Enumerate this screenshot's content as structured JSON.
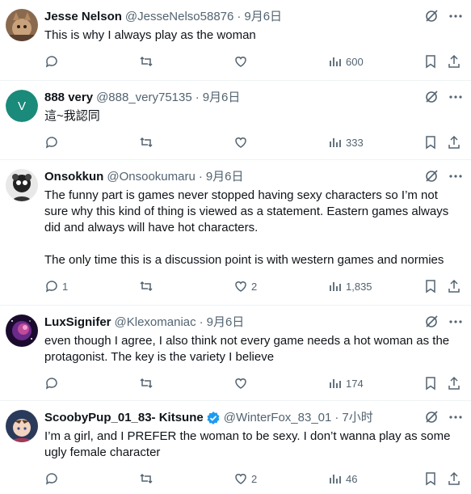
{
  "replies": [
    {
      "name": "Jesse Nelson",
      "handle": "@JesseNelso58876",
      "time": "9月6日",
      "text": [
        "This is why I always play as the woman"
      ],
      "reply_count": "",
      "like_count": "",
      "view_count": "600",
      "avatar": "photo-cat-icon"
    },
    {
      "name": "888 very",
      "handle": "@888_very75135",
      "time": "9月6日",
      "text": [
        "這~我認同"
      ],
      "reply_count": "",
      "like_count": "",
      "view_count": "333",
      "avatar_letter": "V",
      "avatar_color": "#1a8a7a"
    },
    {
      "name": "Onsokkun",
      "handle": "@Onsookumaru",
      "time": "9月6日",
      "text": [
        "The funny part is games never stopped having sexy characters so I’m not sure why this kind of thing is viewed as a statement. Eastern games always did and always will have hot characters.",
        "The only time this is a discussion point is with western games and normies"
      ],
      "reply_count": "1",
      "like_count": "2",
      "view_count": "1,835",
      "avatar": "monochrome-character-icon"
    },
    {
      "name": "LuxSignifer",
      "handle": "@Klexomaniac",
      "time": "9月6日",
      "text": [
        "even though I agree, I also think not every game needs a hot woman as the protagonist. The key is the variety I believe"
      ],
      "reply_count": "",
      "like_count": "",
      "view_count": "174",
      "avatar": "purple-nebula-icon"
    },
    {
      "name": "ScoobyPup_01_83- Kitsune",
      "handle": "@WinterFox_83_01",
      "time": "7小时",
      "verified": true,
      "text": [
        "I’m a girl, and I PREFER the woman to be sexy. I don’t wanna play as some ugly female character"
      ],
      "reply_count": "",
      "like_count": "2",
      "view_count": "46",
      "avatar": "anime-girl-icon"
    }
  ],
  "colors": {
    "text": "#0f1419",
    "muted": "#536471",
    "verified": "#1d9bf0",
    "divider": "#eff3f4"
  }
}
